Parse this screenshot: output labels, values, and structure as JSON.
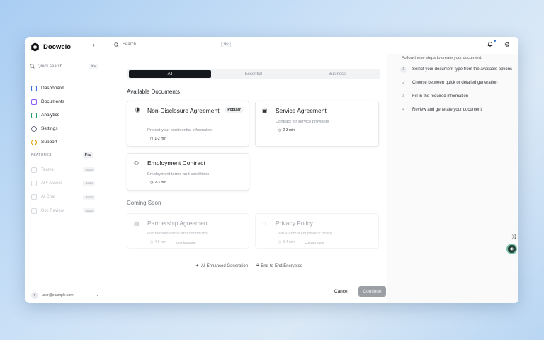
{
  "app": {
    "name": "Docwelo"
  },
  "sidebar": {
    "quick_search": "Quick search...",
    "shortcut": "⌘K",
    "items": [
      {
        "label": "Dashboard",
        "icon": "dashboard-icon",
        "color": "#3b6fd8"
      },
      {
        "label": "Documents",
        "icon": "documents-icon",
        "color": "#8b5cf6"
      },
      {
        "label": "Analytics",
        "icon": "analytics-icon",
        "color": "#22a06b"
      },
      {
        "label": "Settings",
        "icon": "settings-icon",
        "color": "#6b7280"
      },
      {
        "label": "Support",
        "icon": "support-icon",
        "color": "#e0a100"
      }
    ],
    "features_heading": "FEATURES",
    "pro_badge": "Pro",
    "features": [
      {
        "label": "Teams",
        "badge": "Soon"
      },
      {
        "label": "API Access",
        "badge": "Soon"
      },
      {
        "label": "AI Chat",
        "badge": "Soon"
      },
      {
        "label": "Doc Review",
        "badge": "Soon"
      }
    ],
    "account_email": "user@example.com"
  },
  "topbar": {
    "search_placeholder": "Search...",
    "shortcut": "⌘K"
  },
  "main": {
    "tabs": [
      "All",
      "Essential",
      "Business"
    ],
    "available_heading": "Available Documents",
    "coming_soon_heading": "Coming Soon",
    "documents": [
      {
        "title": "Non-Disclosure Agreement",
        "desc": "Protect your confidential information",
        "time": "1-2 min",
        "badge": "Popular"
      },
      {
        "title": "Service Agreement",
        "desc": "Contract for service providers",
        "time": "2-3 min"
      },
      {
        "title": "Employment Contract",
        "desc": "Employment terms and conditions",
        "time": "2-3 min"
      }
    ],
    "coming_soon": [
      {
        "title": "Partnership Agreement",
        "desc": "Partnership terms and conditions",
        "time": "4-5 min",
        "badge": "Coming Soon"
      },
      {
        "title": "Privacy Policy",
        "desc": "GDPR-compliant privacy policy",
        "time": "3-4 min",
        "badge": "Coming Soon"
      }
    ],
    "features": [
      "AI-Enhanced Generation",
      "End-to-End Encrypted"
    ],
    "cancel": "Cancel",
    "continue": "Continue"
  },
  "guide": {
    "intro": "Follow these steps to create your document:",
    "steps": [
      {
        "num": "1",
        "text": "Select your document type from the available options"
      },
      {
        "num": "2",
        "text": "Choose between quick or detailed generation"
      },
      {
        "num": "3",
        "text": "Fill in the required information"
      },
      {
        "num": "4",
        "text": "Review and generate your document"
      }
    ]
  }
}
